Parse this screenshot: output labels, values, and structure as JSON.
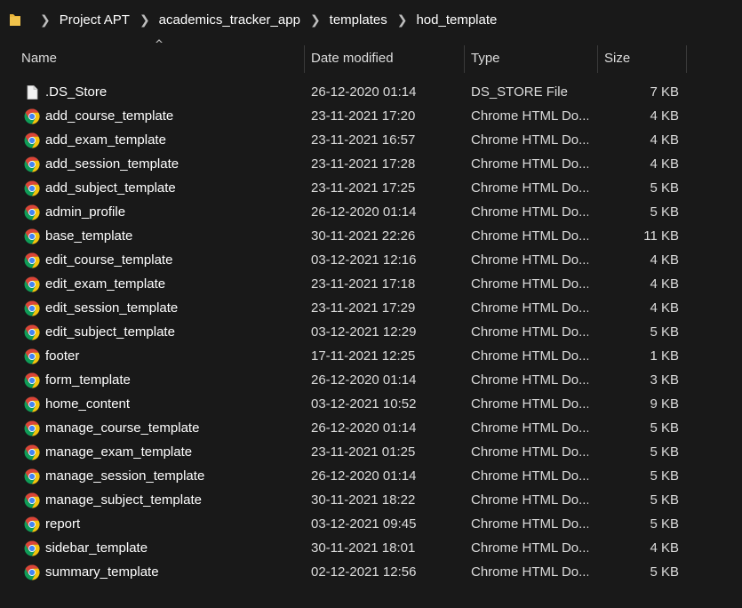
{
  "breadcrumb": [
    "Project APT",
    "academics_tracker_app",
    "templates",
    "hod_template"
  ],
  "columns": {
    "name": "Name",
    "date": "Date modified",
    "type": "Type",
    "size": "Size"
  },
  "files": [
    {
      "name": ".DS_Store",
      "date": "26-12-2020 01:14",
      "type": "DS_STORE File",
      "size": "7 KB",
      "icon": "file-icon"
    },
    {
      "name": "add_course_template",
      "date": "23-11-2021 17:20",
      "type": "Chrome HTML Do...",
      "size": "4 KB",
      "icon": "chrome-icon"
    },
    {
      "name": "add_exam_template",
      "date": "23-11-2021 16:57",
      "type": "Chrome HTML Do...",
      "size": "4 KB",
      "icon": "chrome-icon"
    },
    {
      "name": "add_session_template",
      "date": "23-11-2021 17:28",
      "type": "Chrome HTML Do...",
      "size": "4 KB",
      "icon": "chrome-icon"
    },
    {
      "name": "add_subject_template",
      "date": "23-11-2021 17:25",
      "type": "Chrome HTML Do...",
      "size": "5 KB",
      "icon": "chrome-icon"
    },
    {
      "name": "admin_profile",
      "date": "26-12-2020 01:14",
      "type": "Chrome HTML Do...",
      "size": "5 KB",
      "icon": "chrome-icon"
    },
    {
      "name": "base_template",
      "date": "30-11-2021 22:26",
      "type": "Chrome HTML Do...",
      "size": "11 KB",
      "icon": "chrome-icon"
    },
    {
      "name": "edit_course_template",
      "date": "03-12-2021 12:16",
      "type": "Chrome HTML Do...",
      "size": "4 KB",
      "icon": "chrome-icon"
    },
    {
      "name": "edit_exam_template",
      "date": "23-11-2021 17:18",
      "type": "Chrome HTML Do...",
      "size": "4 KB",
      "icon": "chrome-icon"
    },
    {
      "name": "edit_session_template",
      "date": "23-11-2021 17:29",
      "type": "Chrome HTML Do...",
      "size": "4 KB",
      "icon": "chrome-icon"
    },
    {
      "name": "edit_subject_template",
      "date": "03-12-2021 12:29",
      "type": "Chrome HTML Do...",
      "size": "5 KB",
      "icon": "chrome-icon"
    },
    {
      "name": "footer",
      "date": "17-11-2021 12:25",
      "type": "Chrome HTML Do...",
      "size": "1 KB",
      "icon": "chrome-icon"
    },
    {
      "name": "form_template",
      "date": "26-12-2020 01:14",
      "type": "Chrome HTML Do...",
      "size": "3 KB",
      "icon": "chrome-icon"
    },
    {
      "name": "home_content",
      "date": "03-12-2021 10:52",
      "type": "Chrome HTML Do...",
      "size": "9 KB",
      "icon": "chrome-icon"
    },
    {
      "name": "manage_course_template",
      "date": "26-12-2020 01:14",
      "type": "Chrome HTML Do...",
      "size": "5 KB",
      "icon": "chrome-icon"
    },
    {
      "name": "manage_exam_template",
      "date": "23-11-2021 01:25",
      "type": "Chrome HTML Do...",
      "size": "5 KB",
      "icon": "chrome-icon"
    },
    {
      "name": "manage_session_template",
      "date": "26-12-2020 01:14",
      "type": "Chrome HTML Do...",
      "size": "5 KB",
      "icon": "chrome-icon"
    },
    {
      "name": "manage_subject_template",
      "date": "30-11-2021 18:22",
      "type": "Chrome HTML Do...",
      "size": "5 KB",
      "icon": "chrome-icon"
    },
    {
      "name": "report",
      "date": "03-12-2021 09:45",
      "type": "Chrome HTML Do...",
      "size": "5 KB",
      "icon": "chrome-icon"
    },
    {
      "name": "sidebar_template",
      "date": "30-11-2021 18:01",
      "type": "Chrome HTML Do...",
      "size": "4 KB",
      "icon": "chrome-icon"
    },
    {
      "name": "summary_template",
      "date": "02-12-2021 12:56",
      "type": "Chrome HTML Do...",
      "size": "5 KB",
      "icon": "chrome-icon"
    }
  ],
  "colors": {
    "background": "#191919",
    "folder": "#e8b43a",
    "chrome_red": "#db4437",
    "chrome_yellow": "#f4c20d",
    "chrome_green": "#0f9d58",
    "chrome_blue": "#4285f4"
  }
}
